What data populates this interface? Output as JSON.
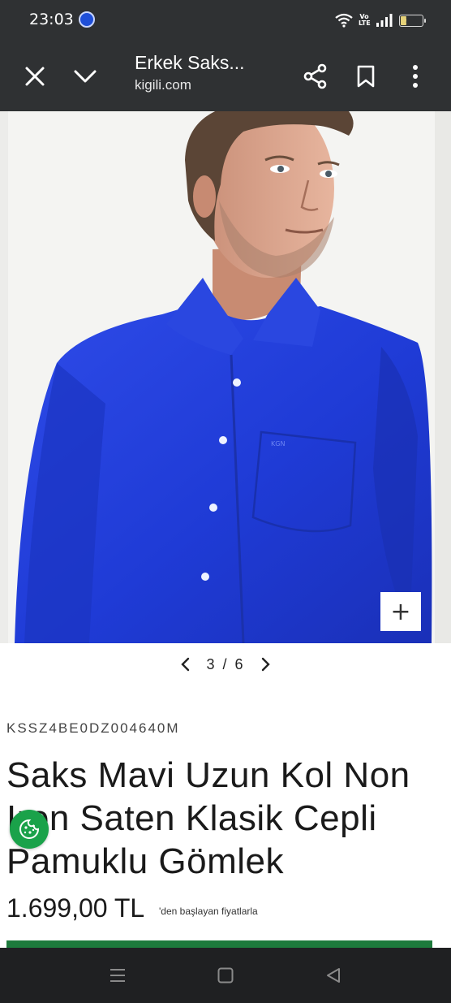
{
  "status_bar": {
    "time": "23:03",
    "volte_label": "Vo LTE",
    "battery_level": "26"
  },
  "header": {
    "title": "Erkek Saks...",
    "url": "kigili.com",
    "icons": [
      "close-icon",
      "chevron-down-icon",
      "share-icon",
      "bookmark-icon",
      "more-vert-icon"
    ]
  },
  "gallery": {
    "zoom_label": "+",
    "current": "3",
    "separator": "/",
    "total": "6",
    "shirt_color": "#1f3bd6",
    "brand_embroidery": "KGN"
  },
  "product": {
    "sku": "KSSZ4BE0DZ004640M",
    "title": "Saks Mavi Uzun Kol Non Iron Saten Klasik Cepli Pamuklu Gömlek",
    "price": "1.699,00 TL",
    "price_note": "'den başlayan fiyatlarla"
  },
  "colors": {
    "header_bg": "#2f3133",
    "accent_green": "#1d7a3c",
    "cookie_green": "#1aa24a"
  }
}
